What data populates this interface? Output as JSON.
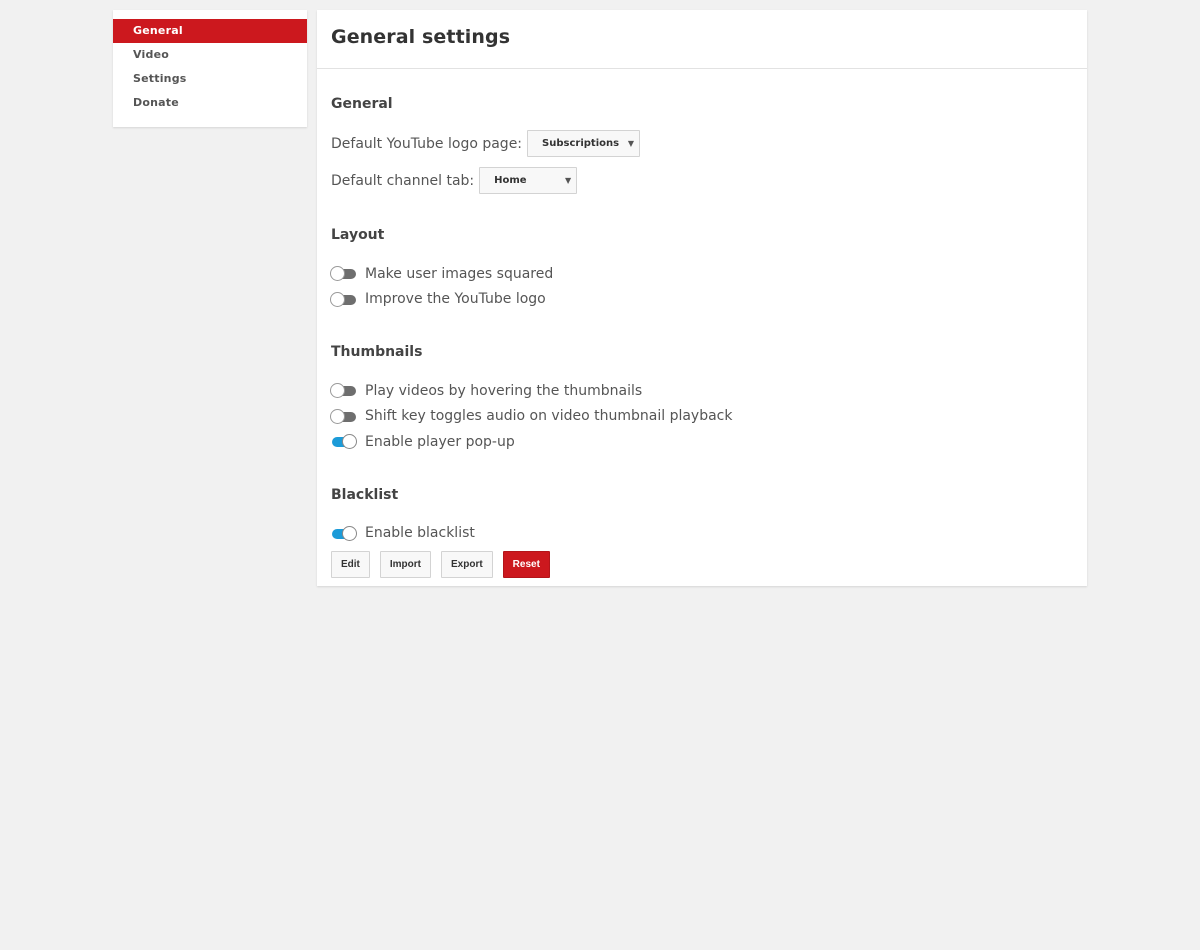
{
  "sidebar": {
    "items": [
      {
        "label": "General",
        "active": true
      },
      {
        "label": "Video",
        "active": false
      },
      {
        "label": "Settings",
        "active": false
      },
      {
        "label": "Donate",
        "active": false
      }
    ]
  },
  "header": {
    "title": "General settings"
  },
  "sections": {
    "general": {
      "title": "General",
      "logo_page": {
        "label": "Default YouTube logo page:",
        "value": "Subscriptions"
      },
      "channel_tab": {
        "label": "Default channel tab:",
        "value": "Home"
      }
    },
    "layout": {
      "title": "Layout",
      "toggles": [
        {
          "label": "Make user images squared",
          "enabled": false
        },
        {
          "label": "Improve the YouTube logo",
          "enabled": false
        }
      ]
    },
    "thumbnails": {
      "title": "Thumbnails",
      "toggles": [
        {
          "label": "Play videos by hovering the thumbnails",
          "enabled": false
        },
        {
          "label": "Shift key toggles audio on video thumbnail playback",
          "enabled": false
        },
        {
          "label": "Enable player pop-up",
          "enabled": true
        }
      ]
    },
    "blacklist": {
      "title": "Blacklist",
      "toggles": [
        {
          "label": "Enable blacklist",
          "enabled": true
        }
      ],
      "buttons": {
        "edit": "Edit",
        "import": "Import",
        "export": "Export",
        "reset": "Reset"
      }
    }
  },
  "icons": {
    "select_arrow": "chevron-down-icon"
  },
  "colors": {
    "accent": "#cc181e",
    "toggle_on": "#1c9bd8",
    "toggle_off": "#6e6e6e",
    "background": "#f1f1f1"
  }
}
